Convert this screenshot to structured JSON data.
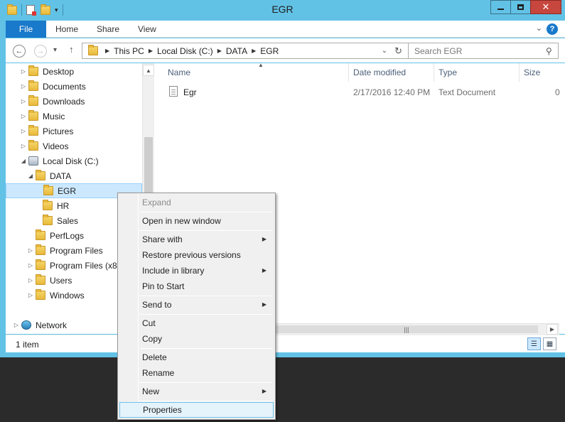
{
  "window": {
    "title": "EGR"
  },
  "ribbon": {
    "file": "File",
    "tabs": [
      "Home",
      "Share",
      "View"
    ],
    "help": "?"
  },
  "nav": {
    "breadcrumbs": [
      "This PC",
      "Local Disk (C:)",
      "DATA",
      "EGR"
    ],
    "search_placeholder": "Search EGR"
  },
  "tree": [
    {
      "label": "Desktop",
      "icon": "folder-icon",
      "level": 1,
      "expander": "collapsed"
    },
    {
      "label": "Documents",
      "icon": "folder-icon",
      "level": 1,
      "expander": "collapsed"
    },
    {
      "label": "Downloads",
      "icon": "folder-icon",
      "level": 1,
      "expander": "collapsed"
    },
    {
      "label": "Music",
      "icon": "folder-icon",
      "level": 1,
      "expander": "collapsed"
    },
    {
      "label": "Pictures",
      "icon": "folder-icon",
      "level": 1,
      "expander": "collapsed"
    },
    {
      "label": "Videos",
      "icon": "folder-icon",
      "level": 1,
      "expander": "collapsed"
    },
    {
      "label": "Local Disk (C:)",
      "icon": "drive-icon",
      "level": 1,
      "expander": "expanded"
    },
    {
      "label": "DATA",
      "icon": "folder-icon",
      "level": 2,
      "expander": "expanded"
    },
    {
      "label": "EGR",
      "icon": "folder-icon",
      "level": 3,
      "expander": "none",
      "selected": true
    },
    {
      "label": "HR",
      "icon": "folder-icon",
      "level": 3,
      "expander": "none"
    },
    {
      "label": "Sales",
      "icon": "folder-icon",
      "level": 3,
      "expander": "none"
    },
    {
      "label": "PerfLogs",
      "icon": "folder-icon",
      "level": 2,
      "expander": "none"
    },
    {
      "label": "Program Files",
      "icon": "folder-icon",
      "level": 2,
      "expander": "collapsed"
    },
    {
      "label": "Program Files (x86",
      "icon": "folder-icon",
      "level": 2,
      "expander": "collapsed"
    },
    {
      "label": "Users",
      "icon": "folder-icon",
      "level": 2,
      "expander": "collapsed"
    },
    {
      "label": "Windows",
      "icon": "folder-icon",
      "level": 2,
      "expander": "collapsed"
    },
    {
      "label": "Network",
      "icon": "network-icon",
      "level": 0,
      "expander": "collapsed"
    }
  ],
  "list": {
    "columns": [
      "Name",
      "Date modified",
      "Type",
      "Size"
    ],
    "rows": [
      {
        "name": "Egr",
        "date": "2/17/2016 12:40 PM",
        "type": "Text Document",
        "size": "0"
      }
    ]
  },
  "status": {
    "items": "1 item"
  },
  "context_menu": [
    {
      "label": "Expand",
      "disabled": true
    },
    {
      "sep": true
    },
    {
      "label": "Open in new window"
    },
    {
      "sep": true
    },
    {
      "label": "Share with",
      "submenu": true
    },
    {
      "label": "Restore previous versions"
    },
    {
      "label": "Include in library",
      "submenu": true
    },
    {
      "label": "Pin to Start"
    },
    {
      "sep": true
    },
    {
      "label": "Send to",
      "submenu": true
    },
    {
      "sep": true
    },
    {
      "label": "Cut"
    },
    {
      "label": "Copy"
    },
    {
      "sep": true
    },
    {
      "label": "Delete"
    },
    {
      "label": "Rename"
    },
    {
      "sep": true
    },
    {
      "label": "New",
      "submenu": true
    },
    {
      "sep": true
    },
    {
      "label": "Properties",
      "highlighted": true
    }
  ],
  "colors": {
    "titlebar": "#62c2e6",
    "file_tab": "#1979ca",
    "selection": "#cce8ff",
    "close": "#c7463d"
  }
}
